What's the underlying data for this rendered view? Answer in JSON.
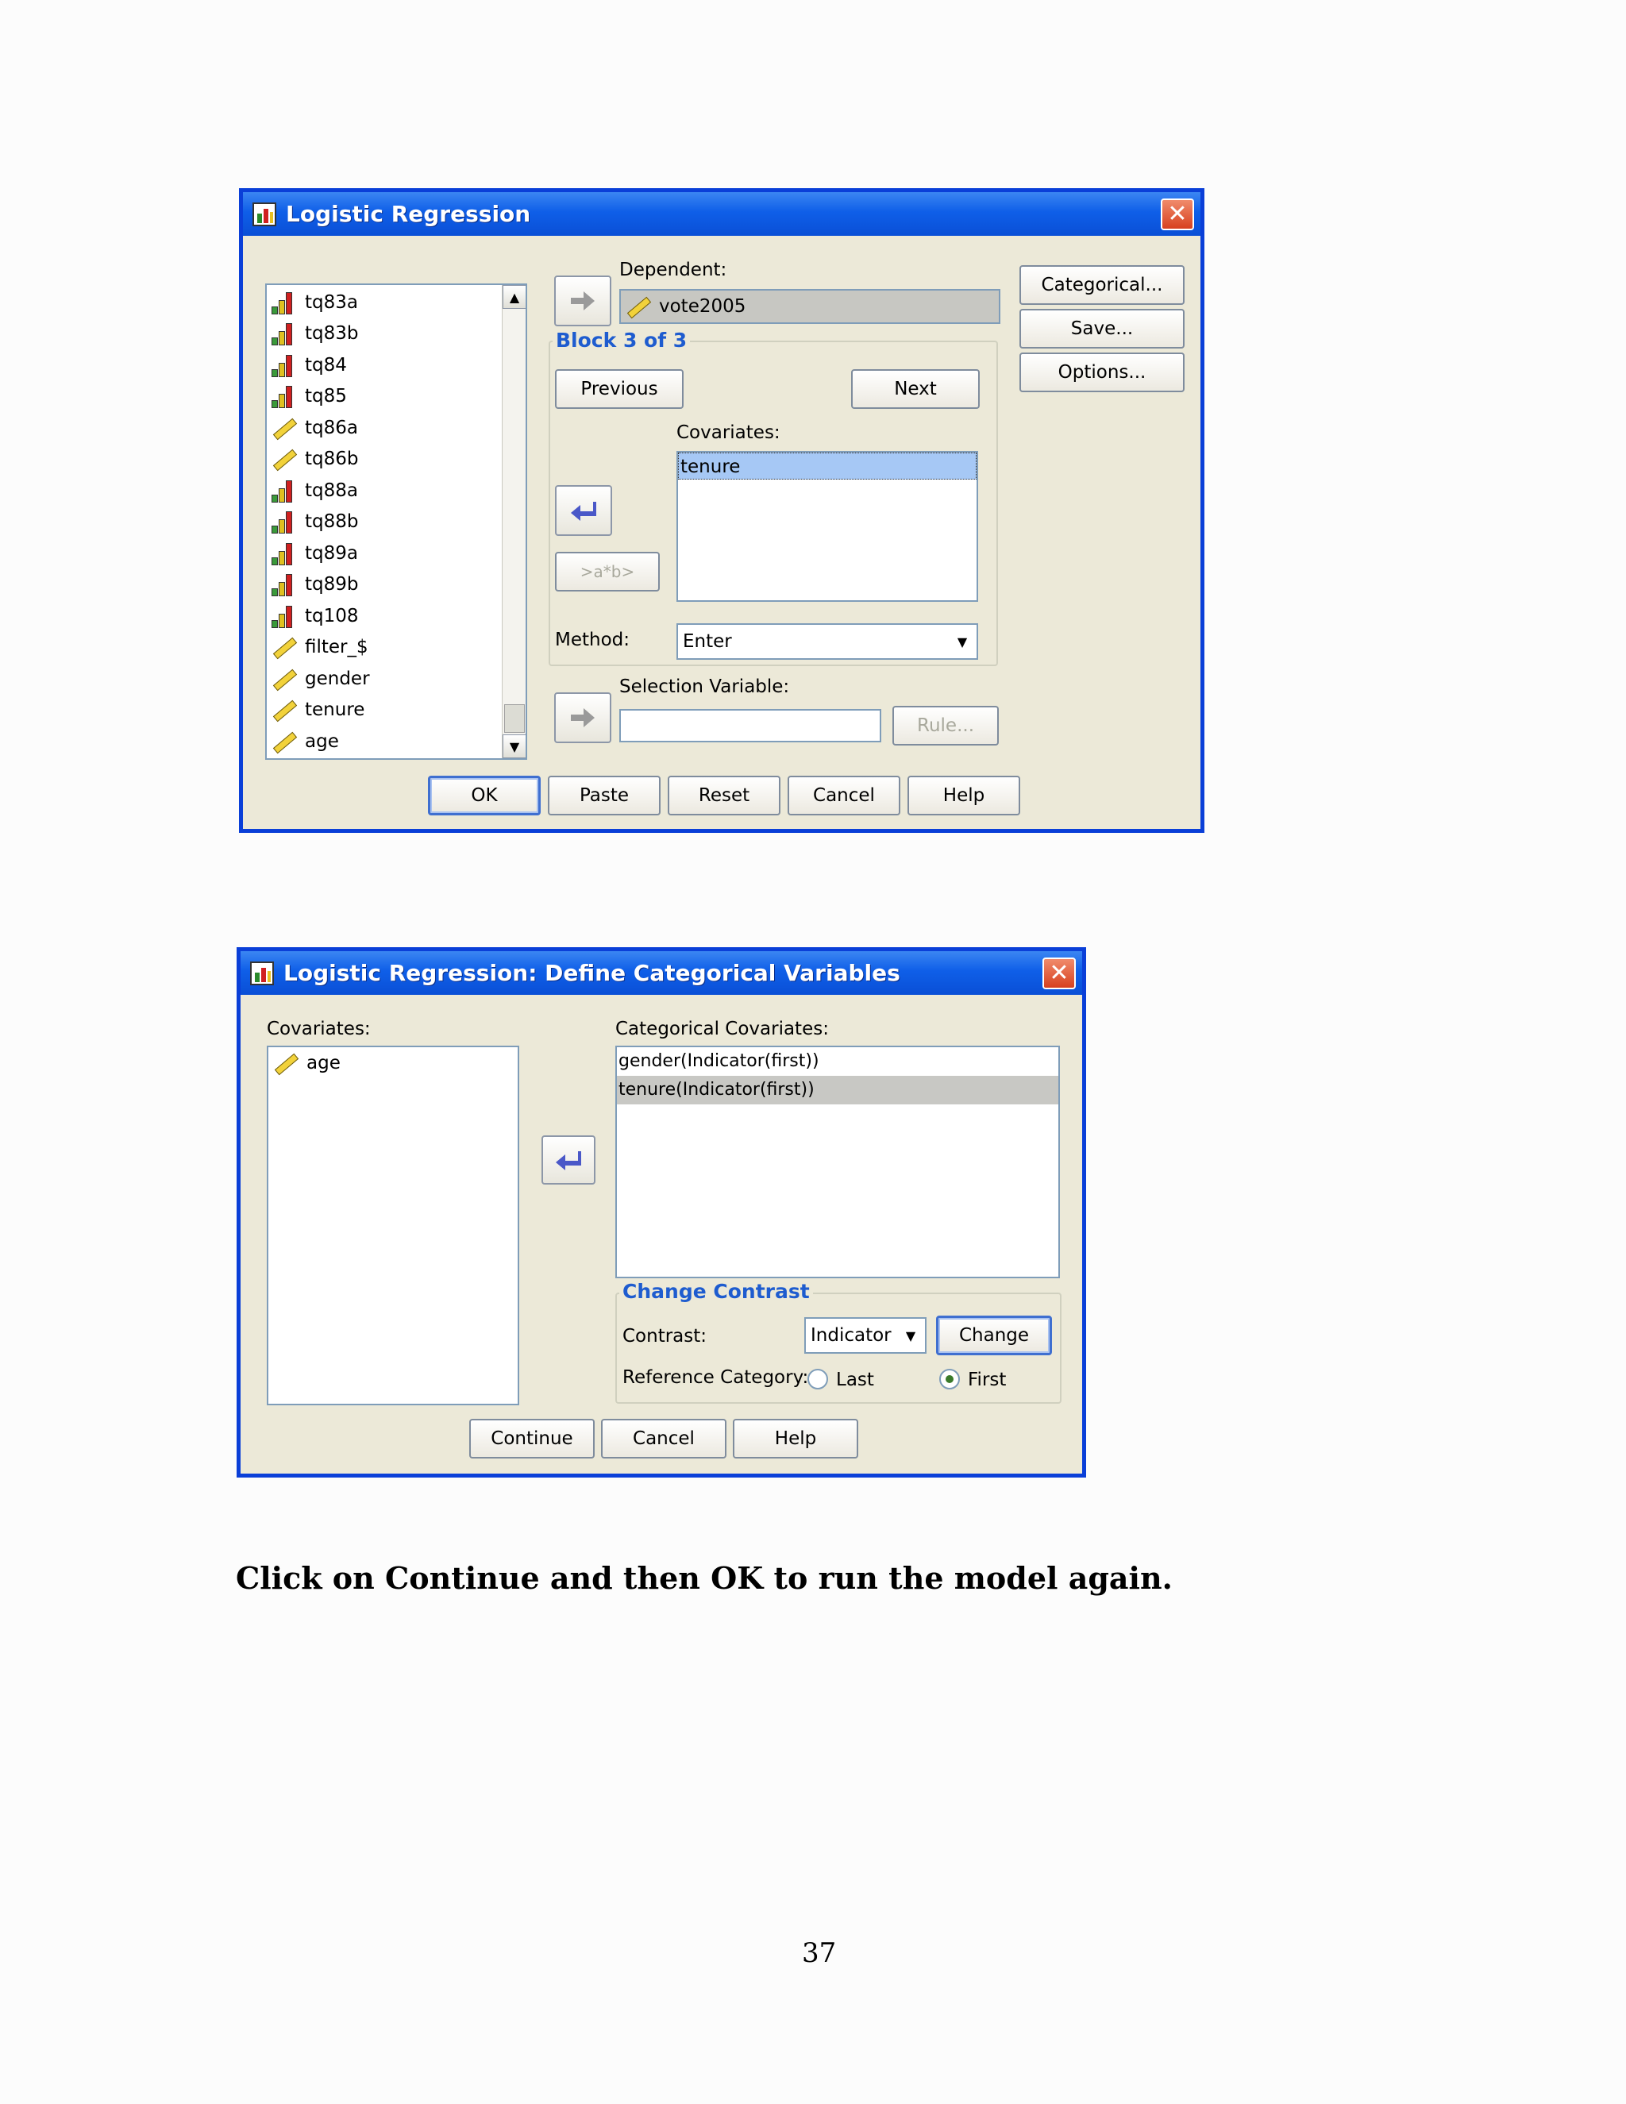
{
  "dialog1": {
    "title": "Logistic Regression",
    "variables": [
      {
        "name": "tq83a",
        "icon": "ordinal-bars-icon"
      },
      {
        "name": "tq83b",
        "icon": "ordinal-bars-icon"
      },
      {
        "name": "tq84",
        "icon": "ordinal-bars-icon"
      },
      {
        "name": "tq85",
        "icon": "ordinal-bars-icon"
      },
      {
        "name": "tq86a",
        "icon": "scale-ruler-icon"
      },
      {
        "name": "tq86b",
        "icon": "scale-ruler-icon"
      },
      {
        "name": "tq88a",
        "icon": "ordinal-bars-icon"
      },
      {
        "name": "tq88b",
        "icon": "ordinal-bars-icon"
      },
      {
        "name": "tq89a",
        "icon": "ordinal-bars-icon"
      },
      {
        "name": "tq89b",
        "icon": "ordinal-bars-icon"
      },
      {
        "name": "tq108",
        "icon": "ordinal-bars-icon"
      },
      {
        "name": "filter_$",
        "icon": "scale-ruler-icon"
      },
      {
        "name": "gender",
        "icon": "scale-ruler-icon"
      },
      {
        "name": "tenure",
        "icon": "scale-ruler-icon"
      },
      {
        "name": "age",
        "icon": "scale-ruler-icon"
      }
    ],
    "dependent_label": "Dependent:",
    "dependent_value": "vote2005",
    "block_title": "Block 3 of 3",
    "previous": "Previous",
    "next": "Next",
    "covariates_label": "Covariates:",
    "covariates": [
      "tenure"
    ],
    "interaction": ">a*b>",
    "method_label": "Method:",
    "method_value": "Enter",
    "selection_label": "Selection Variable:",
    "selection_value": "",
    "rule": "Rule...",
    "side_buttons": {
      "categorical": "Categorical...",
      "save": "Save...",
      "options": "Options..."
    },
    "bottom_buttons": {
      "ok": "OK",
      "paste": "Paste",
      "reset": "Reset",
      "cancel": "Cancel",
      "help": "Help"
    }
  },
  "dialog2": {
    "title": "Logistic Regression: Define Categorical Variables",
    "covariates_label": "Covariates:",
    "covariates": [
      "age"
    ],
    "categorical_label": "Categorical Covariates:",
    "categorical": [
      "gender(Indicator(first))",
      "tenure(Indicator(first))"
    ],
    "change_contrast_title": "Change Contrast",
    "contrast_label": "Contrast:",
    "contrast_value": "Indicator",
    "change": "Change",
    "reference_label": "Reference Category:",
    "last": "Last",
    "first": "First",
    "reference_selected": "First",
    "bottom_buttons": {
      "continue": "Continue",
      "cancel": "Cancel",
      "help": "Help"
    }
  },
  "instruction": "Click on Continue and then OK to run the model again.",
  "page_number": "37",
  "colors": {
    "title_bar": "#0f5fe8",
    "selection": "#a6c8f5",
    "group_title": "#1e5ccf",
    "close": "#d7401e"
  }
}
